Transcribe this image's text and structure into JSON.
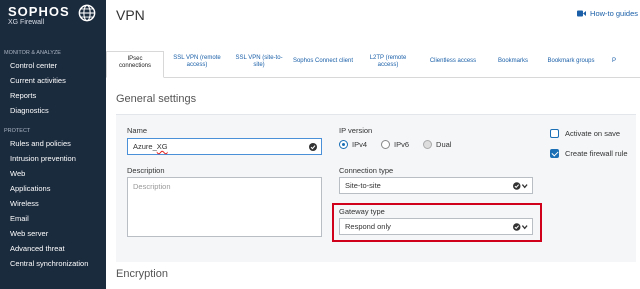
{
  "brand": {
    "name": "SOPHOS",
    "product": "XG Firewall"
  },
  "sidebar": {
    "monitor_title": "MONITOR & ANALYZE",
    "monitor_items": [
      "Control center",
      "Current activities",
      "Reports",
      "Diagnostics"
    ],
    "protect_title": "PROTECT",
    "protect_items": [
      "Rules and policies",
      "Intrusion prevention",
      "Web",
      "Applications",
      "Wireless",
      "Email",
      "Web server",
      "Advanced threat",
      "Central synchronization"
    ]
  },
  "header": {
    "title": "VPN",
    "help_link": "How-to guides"
  },
  "tabs": [
    "IPsec connections",
    "SSL VPN (remote access)",
    "SSL VPN (site-to-site)",
    "Sophos Connect client",
    "L2TP (remote access)",
    "Clientless access",
    "Bookmarks",
    "Bookmark groups",
    "P"
  ],
  "general": {
    "heading": "General settings",
    "name_label": "Name",
    "name_value_prefix": "Azure_",
    "name_value_suffix": "XG",
    "description_label": "Description",
    "description_placeholder": "Description",
    "ip_version_label": "IP version",
    "ip_options": [
      "IPv4",
      "IPv6",
      "Dual"
    ],
    "ip_selected": "IPv4",
    "connection_type_label": "Connection type",
    "connection_type_value": "Site-to-site",
    "gateway_type_label": "Gateway type",
    "gateway_type_value": "Respond only",
    "activate_label": "Activate on save",
    "activate_checked": false,
    "firewall_label": "Create firewall rule",
    "firewall_checked": true
  },
  "encryption": {
    "heading": "Encryption"
  },
  "colors": {
    "sidebar": "#1b2b3e",
    "accent": "#1a6fb5",
    "link": "#1a5fa8",
    "highlight": "#d0021b"
  }
}
